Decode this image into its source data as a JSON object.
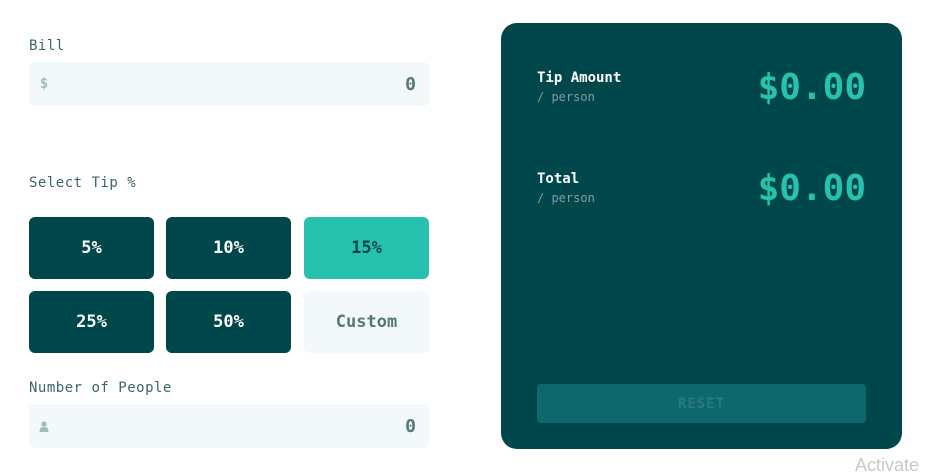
{
  "bill": {
    "label": "Bill",
    "currency_glyph": "$",
    "value": "0"
  },
  "tip": {
    "label": "Select Tip %",
    "options": [
      {
        "label": "5%",
        "selected": false
      },
      {
        "label": "10%",
        "selected": false
      },
      {
        "label": "15%",
        "selected": true
      },
      {
        "label": "25%",
        "selected": false
      },
      {
        "label": "50%",
        "selected": false
      }
    ],
    "custom_label": "Custom"
  },
  "people": {
    "label": "Number of People",
    "icon": "person-icon",
    "value": "0"
  },
  "results": {
    "tip_amount": {
      "title": "Tip Amount",
      "sub": "/ person",
      "value": "$0.00"
    },
    "total": {
      "title": "Total",
      "sub": "/ person",
      "value": "$0.00"
    },
    "reset_label": "RESET"
  },
  "watermark": "Activate",
  "colors": {
    "dark_cyan": "#00474b",
    "strong_cyan": "#26c2ae",
    "light_grey_cyan": "#f3f9fa",
    "reset_disabled": "#0d686d"
  }
}
